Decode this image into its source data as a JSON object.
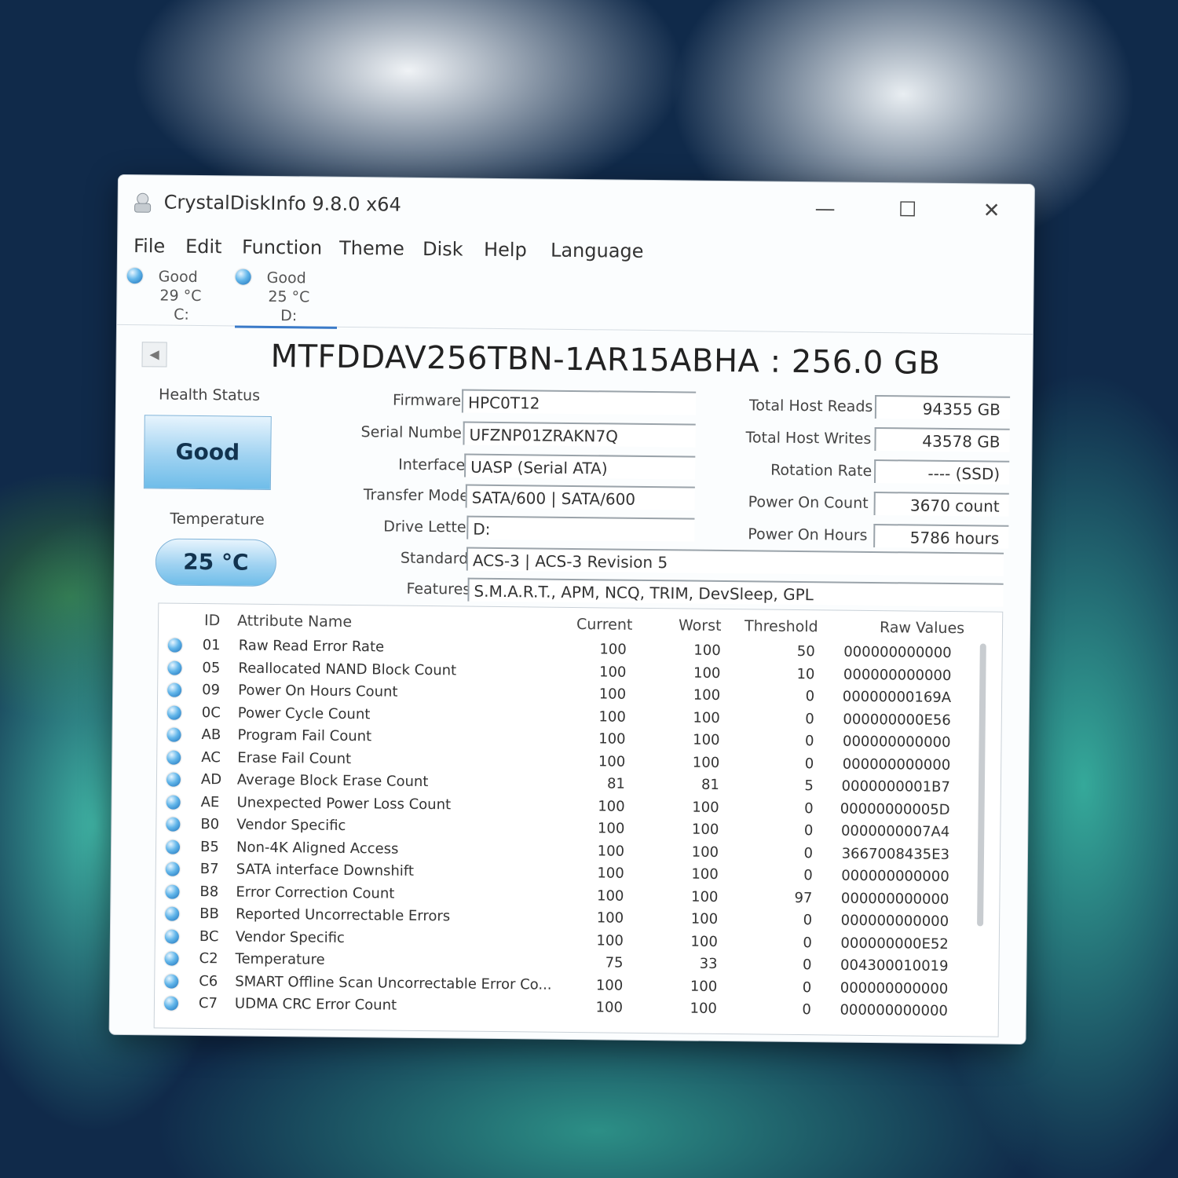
{
  "window": {
    "title": "CrystalDiskInfo 9.8.0 x64"
  },
  "menu": [
    "File",
    "Edit",
    "Function",
    "Theme",
    "Disk",
    "Help",
    "Language"
  ],
  "drives": [
    {
      "status": "Good",
      "temp": "29 °C",
      "letter": "C:"
    },
    {
      "status": "Good",
      "temp": "25 °C",
      "letter": "D:"
    }
  ],
  "model_title": "MTFDDAV256TBN-1AR15ABHA : 256.0 GB",
  "health": {
    "label": "Health Status",
    "value": "Good"
  },
  "temperature": {
    "label": "Temperature",
    "value": "25 °C"
  },
  "info": {
    "firmware": {
      "label": "Firmware",
      "value": "HPC0T12"
    },
    "serial": {
      "label": "Serial Number",
      "value": "UFZNP01ZRAKN7Q"
    },
    "interface": {
      "label": "Interface",
      "value": "UASP (Serial ATA)"
    },
    "transfer": {
      "label": "Transfer Mode",
      "value": "SATA/600 | SATA/600"
    },
    "drive_letter": {
      "label": "Drive Letter",
      "value": "D:"
    },
    "standard": {
      "label": "Standard",
      "value": "ACS-3 | ACS-3 Revision 5"
    },
    "features": {
      "label": "Features",
      "value": "S.M.A.R.T., APM, NCQ, TRIM, DevSleep, GPL"
    }
  },
  "stats": {
    "reads": {
      "label": "Total Host Reads",
      "value": "94355 GB"
    },
    "writes": {
      "label": "Total Host Writes",
      "value": "43578 GB"
    },
    "rotation": {
      "label": "Rotation Rate",
      "value": "---- (SSD)"
    },
    "power_count": {
      "label": "Power On Count",
      "value": "3670 count"
    },
    "power_hours": {
      "label": "Power On Hours",
      "value": "5786 hours"
    }
  },
  "table": {
    "headers": {
      "id": "ID",
      "name": "Attribute Name",
      "current": "Current",
      "worst": "Worst",
      "threshold": "Threshold",
      "raw": "Raw Values"
    },
    "rows": [
      {
        "id": "01",
        "name": "Raw Read Error Rate",
        "current": "100",
        "worst": "100",
        "threshold": "50",
        "raw": "000000000000"
      },
      {
        "id": "05",
        "name": "Reallocated NAND Block Count",
        "current": "100",
        "worst": "100",
        "threshold": "10",
        "raw": "000000000000"
      },
      {
        "id": "09",
        "name": "Power On Hours Count",
        "current": "100",
        "worst": "100",
        "threshold": "0",
        "raw": "00000000169A"
      },
      {
        "id": "0C",
        "name": "Power Cycle Count",
        "current": "100",
        "worst": "100",
        "threshold": "0",
        "raw": "000000000E56"
      },
      {
        "id": "AB",
        "name": "Program Fail Count",
        "current": "100",
        "worst": "100",
        "threshold": "0",
        "raw": "000000000000"
      },
      {
        "id": "AC",
        "name": "Erase Fail Count",
        "current": "100",
        "worst": "100",
        "threshold": "0",
        "raw": "000000000000"
      },
      {
        "id": "AD",
        "name": "Average Block Erase Count",
        "current": "81",
        "worst": "81",
        "threshold": "5",
        "raw": "0000000001B7"
      },
      {
        "id": "AE",
        "name": "Unexpected Power Loss Count",
        "current": "100",
        "worst": "100",
        "threshold": "0",
        "raw": "00000000005D"
      },
      {
        "id": "B0",
        "name": "Vendor Specific",
        "current": "100",
        "worst": "100",
        "threshold": "0",
        "raw": "0000000007A4"
      },
      {
        "id": "B5",
        "name": "Non-4K Aligned Access",
        "current": "100",
        "worst": "100",
        "threshold": "0",
        "raw": "3667008435E3"
      },
      {
        "id": "B7",
        "name": "SATA interface Downshift",
        "current": "100",
        "worst": "100",
        "threshold": "0",
        "raw": "000000000000"
      },
      {
        "id": "B8",
        "name": "Error Correction Count",
        "current": "100",
        "worst": "100",
        "threshold": "97",
        "raw": "000000000000"
      },
      {
        "id": "BB",
        "name": "Reported Uncorrectable Errors",
        "current": "100",
        "worst": "100",
        "threshold": "0",
        "raw": "000000000000"
      },
      {
        "id": "BC",
        "name": "Vendor Specific",
        "current": "100",
        "worst": "100",
        "threshold": "0",
        "raw": "000000000E52"
      },
      {
        "id": "C2",
        "name": "Temperature",
        "current": "75",
        "worst": "33",
        "threshold": "0",
        "raw": "004300010019"
      },
      {
        "id": "C6",
        "name": "SMART Offline Scan Uncorrectable Error Co...",
        "current": "100",
        "worst": "100",
        "threshold": "0",
        "raw": "000000000000"
      },
      {
        "id": "C7",
        "name": "UDMA CRC Error Count",
        "current": "100",
        "worst": "100",
        "threshold": "0",
        "raw": "000000000000"
      }
    ]
  }
}
